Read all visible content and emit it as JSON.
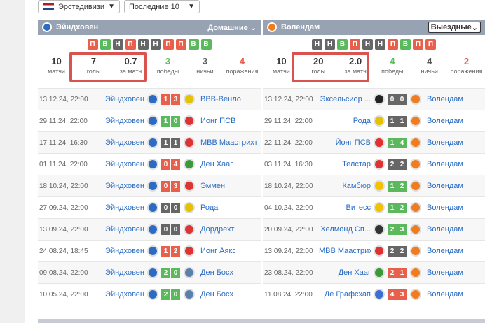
{
  "top": {
    "league": "Эрстедивизи",
    "range": "Последние 10"
  },
  "left": {
    "team": "Эйндховен",
    "filter": "Домашние",
    "form": [
      "П",
      "В",
      "Н",
      "П",
      "Н",
      "Н",
      "П",
      "П",
      "В",
      "В"
    ],
    "stats": [
      {
        "n": "10",
        "l": "матчи",
        "c": ""
      },
      {
        "n": "7",
        "l": "голы",
        "c": ""
      },
      {
        "n": "0.7",
        "l": "за матч",
        "c": ""
      },
      {
        "n": "3",
        "l": "победы",
        "c": "green"
      },
      {
        "n": "3",
        "l": "ничьи",
        "c": "grey"
      },
      {
        "n": "4",
        "l": "поражения",
        "c": "red"
      }
    ],
    "matches": [
      {
        "date": "13.12.24, 22:00",
        "home": "Эйндховен",
        "s1": "1",
        "s2": "3",
        "r": "l",
        "away": "ВВВ-Венло"
      },
      {
        "date": "29.11.24, 22:00",
        "home": "Эйндховен",
        "s1": "1",
        "s2": "0",
        "r": "w",
        "away": "Йонг ПСВ"
      },
      {
        "date": "17.11.24, 16:30",
        "home": "Эйндховен",
        "s1": "1",
        "s2": "1",
        "r": "d",
        "away": "МВВ Маастрихт"
      },
      {
        "date": "01.11.24, 22:00",
        "home": "Эйндховен",
        "s1": "0",
        "s2": "4",
        "r": "l",
        "away": "Ден Хааг"
      },
      {
        "date": "18.10.24, 22:00",
        "home": "Эйндховен",
        "s1": "0",
        "s2": "3",
        "r": "l",
        "away": "Эммен"
      },
      {
        "date": "27.09.24, 22:00",
        "home": "Эйндховен",
        "s1": "0",
        "s2": "0",
        "r": "d",
        "away": "Рода"
      },
      {
        "date": "13.09.24, 22:00",
        "home": "Эйндховен",
        "s1": "0",
        "s2": "0",
        "r": "d",
        "away": "Дордрехт"
      },
      {
        "date": "24.08.24, 18:45",
        "home": "Эйндховен",
        "s1": "1",
        "s2": "2",
        "r": "l",
        "away": "Йонг Аякс"
      },
      {
        "date": "09.08.24, 22:00",
        "home": "Эйндховен",
        "s1": "2",
        "s2": "0",
        "r": "w",
        "away": "Ден Босх"
      },
      {
        "date": "10.05.24, 22:00",
        "home": "Эйндховен",
        "s1": "2",
        "s2": "0",
        "r": "w",
        "away": "Ден Босх"
      }
    ]
  },
  "right": {
    "team": "Волендам",
    "filter": "Выездные",
    "form": [
      "Н",
      "Н",
      "В",
      "П",
      "Н",
      "Н",
      "П",
      "В",
      "П",
      "П"
    ],
    "stats": [
      {
        "n": "10",
        "l": "матчи",
        "c": ""
      },
      {
        "n": "20",
        "l": "голы",
        "c": ""
      },
      {
        "n": "2.0",
        "l": "за матч",
        "c": ""
      },
      {
        "n": "4",
        "l": "победы",
        "c": "green"
      },
      {
        "n": "4",
        "l": "ничьи",
        "c": "grey"
      },
      {
        "n": "2",
        "l": "поражения",
        "c": "red"
      }
    ],
    "matches": [
      {
        "date": "13.12.24, 22:00",
        "home": "Эксельсиор ...",
        "s1": "0",
        "s2": "0",
        "r": "d",
        "away": "Волендам"
      },
      {
        "date": "29.11.24, 22:00",
        "home": "Рода",
        "s1": "1",
        "s2": "1",
        "r": "d",
        "away": "Волендам"
      },
      {
        "date": "22.11.24, 22:00",
        "home": "Йонг ПСВ",
        "s1": "1",
        "s2": "4",
        "r": "w",
        "away": "Волендам"
      },
      {
        "date": "03.11.24, 16:30",
        "home": "Телстар",
        "s1": "2",
        "s2": "2",
        "r": "d",
        "away": "Волендам"
      },
      {
        "date": "18.10.24, 22:00",
        "home": "Камбюр",
        "s1": "1",
        "s2": "2",
        "r": "w",
        "away": "Волендам"
      },
      {
        "date": "04.10.24, 22:00",
        "home": "Витесс",
        "s1": "1",
        "s2": "2",
        "r": "w",
        "away": "Волендам"
      },
      {
        "date": "20.09.24, 22:00",
        "home": "Хелмонд Сп...",
        "s1": "2",
        "s2": "3",
        "r": "w",
        "away": "Волендам"
      },
      {
        "date": "13.09.24, 22:00",
        "home": "МВВ Маастрихт",
        "s1": "2",
        "s2": "2",
        "r": "d",
        "away": "Волендам"
      },
      {
        "date": "23.08.24, 22:00",
        "home": "Ден Хааг",
        "s1": "2",
        "s2": "1",
        "r": "l",
        "away": "Волендам"
      },
      {
        "date": "11.08.24, 22:00",
        "home": "Де Графсхап",
        "s1": "4",
        "s2": "3",
        "r": "l",
        "away": "Волендам"
      }
    ]
  },
  "colors": {
    "win": "#5cb85c",
    "loss": "#e8604c",
    "draw": "#666666"
  }
}
